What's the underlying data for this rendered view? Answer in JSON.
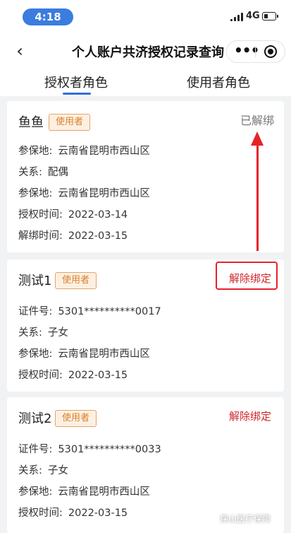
{
  "status_bar": {
    "time": "4:18",
    "network": "4G"
  },
  "nav": {
    "back_glyph": "‹",
    "title": "个人账户共济授权记录查询",
    "more_glyph": "•••"
  },
  "tabs": [
    {
      "label": "授权者角色",
      "active": true
    },
    {
      "label": "使用者角色",
      "active": false
    }
  ],
  "cards": [
    {
      "name": "鱼鱼",
      "role": "使用者",
      "status": "已解绑",
      "rows": [
        {
          "label": "参保地:",
          "value": "云南省昆明市西山区"
        },
        {
          "label": "关系:",
          "value": "配偶"
        },
        {
          "label": "参保地:",
          "value": "云南省昆明市西山区"
        },
        {
          "label": "授权时间:",
          "value": "2022-03-14"
        },
        {
          "label": "解绑时间:",
          "value": "2022-03-15"
        }
      ]
    },
    {
      "name": "测试1",
      "role": "使用者",
      "action": "解除绑定",
      "rows": [
        {
          "label": "证件号:",
          "value": "5301**********0017"
        },
        {
          "label": "关系:",
          "value": "子女"
        },
        {
          "label": "参保地:",
          "value": "云南省昆明市西山区"
        },
        {
          "label": "授权时间:",
          "value": "2022-03-15"
        }
      ]
    },
    {
      "name": "测试2",
      "role": "使用者",
      "action": "解除绑定",
      "rows": [
        {
          "label": "证件号:",
          "value": "5301**********0033"
        },
        {
          "label": "关系:",
          "value": "子女"
        },
        {
          "label": "参保地:",
          "value": "云南省昆明市西山区"
        },
        {
          "label": "授权时间:",
          "value": "2022-03-15"
        }
      ]
    }
  ],
  "watermark": "保山医疗保障",
  "colors": {
    "accent_blue": "#2f6fdd",
    "badge_orange": "#d9822b",
    "alert_red": "#d0262b"
  }
}
